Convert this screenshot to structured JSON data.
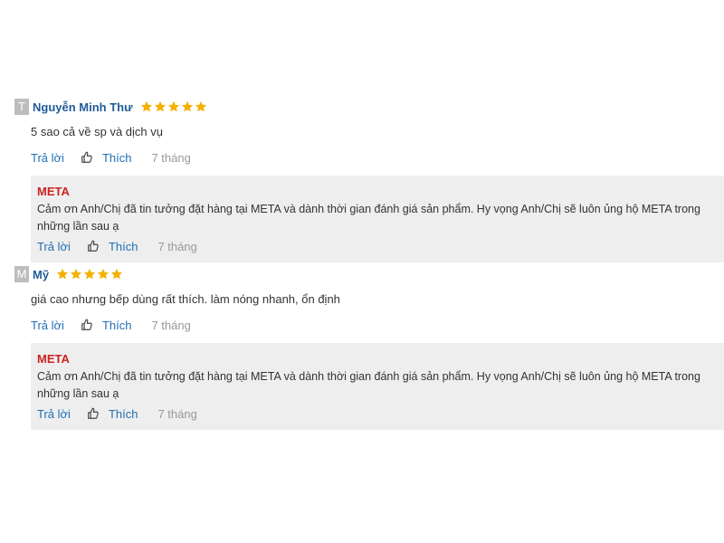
{
  "reviews": [
    {
      "avatar_letter": "T",
      "author": "Nguyễn Minh Thư",
      "rating": 5,
      "content": "5 sao cả về sp và dịch vụ",
      "reply_label": "Trả lời",
      "like_label": "Thích",
      "time": "7 tháng",
      "reply": {
        "name": "META",
        "text": "Cảm ơn Anh/Chị đã tin tưởng đặt hàng tại META và dành thời gian đánh giá sản phẩm. Hy vọng Anh/Chị sẽ luôn ủng hộ META trong những lần sau ạ",
        "reply_label": "Trả lời",
        "like_label": "Thích",
        "time": "7 tháng"
      }
    },
    {
      "avatar_letter": "M",
      "author": "Mỹ",
      "rating": 5,
      "content": "giá cao nhưng bếp dùng rất thích. làm nóng nhanh, ổn định",
      "reply_label": "Trả lời",
      "like_label": "Thích",
      "time": "7 tháng",
      "reply": {
        "name": "META",
        "text": "Cảm ơn Anh/Chị đã tin tưởng đặt hàng tại META và dành thời gian đánh giá sản phẩm. Hy vọng Anh/Chị sẽ luôn ủng hộ META trong những lần sau ạ",
        "reply_label": "Trả lời",
        "like_label": "Thích",
        "time": "7 tháng"
      }
    }
  ],
  "colors": {
    "star": "#f5b000",
    "author": "#1f5c99",
    "link": "#1f6fb5",
    "reply_name": "#cc2222",
    "reply_bg": "#eeeeee"
  },
  "icons": {
    "star": "star-icon",
    "like": "thumbs-up-icon"
  }
}
